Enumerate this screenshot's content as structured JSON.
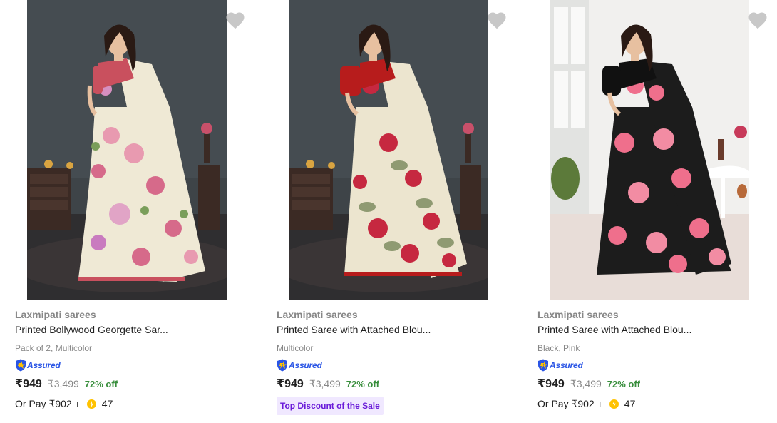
{
  "products": [
    {
      "brand": "Laxmipati sarees",
      "title": "Printed Bollywood Georgette Sar...",
      "variant": "Pack of 2, Multicolor",
      "assured_label": "Assured",
      "price": "₹949",
      "mrp": "₹3,499",
      "discount": "72% off",
      "pay_prefix": "Or Pay ₹902 +",
      "coins": "47",
      "image_icon": "saree-model-image",
      "colors": {
        "backdrop": "#3d4347",
        "saree": "#efe9d5",
        "blouse": "#c9505e",
        "print": "#d66a8a"
      }
    },
    {
      "brand": "Laxmipati sarees",
      "title": "Printed Saree with Attached Blou...",
      "variant": "Multicolor",
      "assured_label": "Assured",
      "price": "₹949",
      "mrp": "₹3,499",
      "discount": "72% off",
      "badge": "Top Discount of the Sale",
      "image_icon": "saree-model-image",
      "colors": {
        "backdrop": "#3d4347",
        "saree": "#ece5cf",
        "blouse": "#b71c1c",
        "print": "#c62840"
      }
    },
    {
      "brand": "Laxmipati sarees",
      "title": "Printed Saree with Attached Blou...",
      "variant": "Black, Pink",
      "assured_label": "Assured",
      "price": "₹949",
      "mrp": "₹3,499",
      "discount": "72% off",
      "pay_prefix": "Or Pay ₹902 +",
      "coins": "47",
      "image_icon": "saree-model-image",
      "colors": {
        "backdrop": "#ecebe8",
        "saree": "#1c1c1c",
        "blouse": "#111111",
        "print": "#ef6f8c"
      }
    }
  ],
  "theme": {
    "price": "#212121",
    "muted": "#878787",
    "discount": "#388e3c",
    "assured": "#2a55e5",
    "badge_bg": "#f0e8ff",
    "badge_text": "#6a1bd9",
    "wishlist": "#c2c2c2"
  }
}
